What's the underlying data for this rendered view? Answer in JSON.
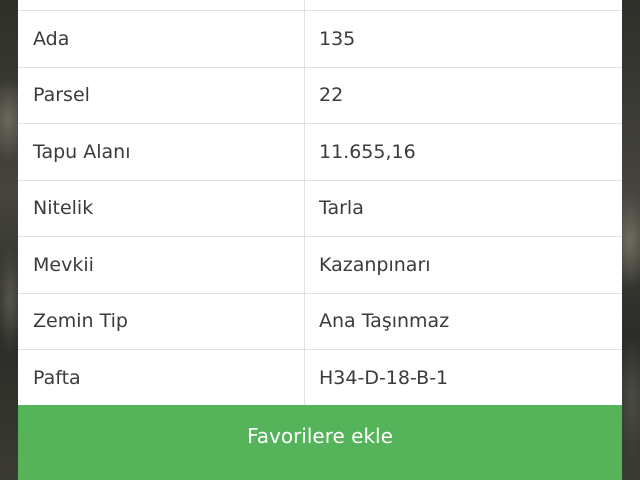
{
  "parcel_info": {
    "rows": [
      {
        "label": "Ada",
        "value": "135"
      },
      {
        "label": "Parsel",
        "value": "22"
      },
      {
        "label": "Tapu Alanı",
        "value": "11.655,16"
      },
      {
        "label": "Nitelik",
        "value": "Tarla"
      },
      {
        "label": "Mevkii",
        "value": "Kazanpınarı"
      },
      {
        "label": "Zemin Tip",
        "value": "Ana Taşınmaz"
      },
      {
        "label": "Pafta",
        "value": "H34-D-18-B-1"
      }
    ]
  },
  "actions": {
    "favorite_label": "Favorilere ekle"
  },
  "colors": {
    "button": "#55b45a",
    "text": "#3b3b3b",
    "divider": "#e2e2e2"
  }
}
